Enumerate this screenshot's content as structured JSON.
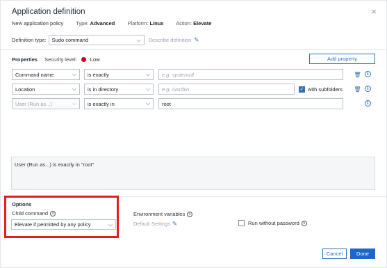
{
  "dialog": {
    "title": "Application definition",
    "close_glyph": "×"
  },
  "meta": {
    "policy": "New application policy",
    "type_label": "Type:",
    "type_value": "Advanced",
    "platform_label": "Platform:",
    "platform_value": "Linux",
    "action_label": "Action:",
    "action_value": "Elevate"
  },
  "definition": {
    "label": "Definition type:",
    "value": "Sudo command",
    "describe_label": "Describe definition"
  },
  "properties": {
    "title": "Properties",
    "security_label": "Security level:",
    "security_value": "Low",
    "security_color": "#d0021b",
    "add_button": "Add property",
    "rows": [
      {
        "property": "Command name",
        "operator": "is exactly",
        "value": "",
        "placeholder": "e.g. systemctl",
        "disabled": false,
        "checkbox_label": "",
        "deletable": true
      },
      {
        "property": "Location",
        "operator": "is in directory",
        "value": "",
        "placeholder": "e.g. /usr/bin",
        "disabled": false,
        "checkbox_label": "with subfolders",
        "checkbox_checked": true,
        "deletable": true
      },
      {
        "property": "User (Run as...)",
        "operator": "is exactly in",
        "value": "root",
        "placeholder": "",
        "disabled": true,
        "checkbox_label": "",
        "deletable": false
      }
    ]
  },
  "summary_text": "User (Run as...) is exactly in \"root\"",
  "options": {
    "title": "Options",
    "child_command_label": "Child command",
    "child_command_value": "Elevate if permitted by any policy",
    "env_label": "Environment variables",
    "env_value": "Default Settings",
    "run_without_password_label": "Run without password",
    "run_without_password_checked": false
  },
  "footer": {
    "cancel": "Cancel",
    "done": "Done"
  },
  "colors": {
    "accent": "#2f6fb5",
    "primary_button": "#1f66c7",
    "highlight": "#e0201b"
  }
}
